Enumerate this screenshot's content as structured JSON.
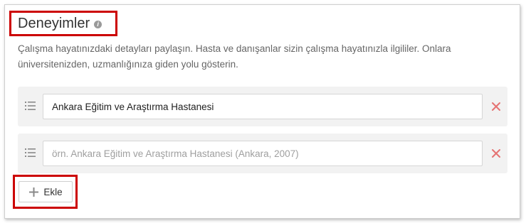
{
  "section": {
    "title": "Deneyimler",
    "info_icon": "info-icon",
    "description": "Çalışma hayatınızdaki detayları paylaşın. Hasta ve danışanlar sizin çalışma hayatınızla ilgililer. Onlara üniversitenizden, uzmanlığınıza giden yolu gösterin."
  },
  "experiences": [
    {
      "value": "Ankara Eğitim ve Araştırma Hastanesi",
      "placeholder": ""
    },
    {
      "value": "",
      "placeholder": "örn. Ankara Eğitim ve Araştırma Hastanesi (Ankara, 2007)"
    }
  ],
  "add_button": {
    "label": "Ekle"
  },
  "colors": {
    "highlight_border": "#cc0000",
    "remove_icon": "#e57373",
    "row_background": "#f2f2f2"
  }
}
